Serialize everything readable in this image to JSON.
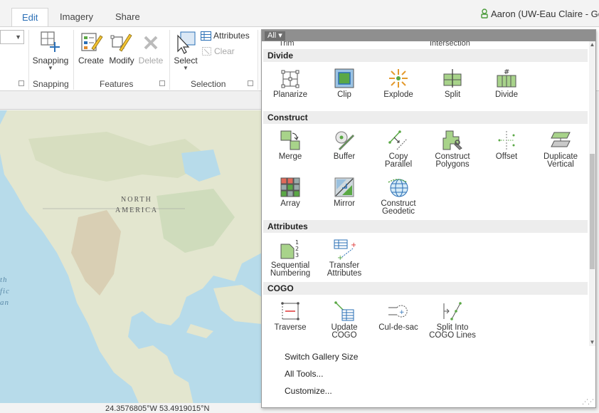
{
  "tabs": [
    {
      "label": "Edit",
      "active": true
    },
    {
      "label": "Imagery",
      "active": false
    },
    {
      "label": "Share",
      "active": false
    }
  ],
  "user": {
    "label": "Aaron (UW-Eau Claire - Geog"
  },
  "ribbon": {
    "snapping": {
      "button_label": "Snapping",
      "group_label": "Snapping"
    },
    "features": {
      "create": "Create",
      "modify": "Modify",
      "delete": "Delete",
      "group_label": "Features"
    },
    "selection": {
      "select": "Select",
      "attributes": "Attributes",
      "clear": "Clear",
      "group_label": "Selection"
    }
  },
  "map": {
    "labels": {
      "north": "NORTH",
      "america": "AMERICA",
      "pacific_1": "th",
      "pacific_2": "fic",
      "pacific_3": "an"
    }
  },
  "status": {
    "coordinates": "24.3576805°W 53.4919015°N"
  },
  "gallery": {
    "filter_label": "All",
    "cut_labels": [
      "Trim",
      "Intersection"
    ],
    "categories": {
      "divide": "Divide",
      "construct": "Construct",
      "attributes": "Attributes",
      "cogo": "COGO"
    },
    "tools": {
      "planarize": {
        "l1": "Planarize",
        "l2": ""
      },
      "clip": {
        "l1": "Clip",
        "l2": ""
      },
      "explode": {
        "l1": "Explode",
        "l2": ""
      },
      "split": {
        "l1": "Split",
        "l2": ""
      },
      "divide": {
        "l1": "Divide",
        "l2": ""
      },
      "merge": {
        "l1": "Merge",
        "l2": ""
      },
      "buffer": {
        "l1": "Buffer",
        "l2": ""
      },
      "copy_parallel": {
        "l1": "Copy",
        "l2": "Parallel"
      },
      "construct_polygons": {
        "l1": "Construct",
        "l2": "Polygons"
      },
      "offset": {
        "l1": "Offset",
        "l2": ""
      },
      "duplicate_vertical": {
        "l1": "Duplicate",
        "l2": "Vertical"
      },
      "array": {
        "l1": "Array",
        "l2": ""
      },
      "mirror": {
        "l1": "Mirror",
        "l2": ""
      },
      "construct_geodetic": {
        "l1": "Construct",
        "l2": "Geodetic"
      },
      "sequential_numbering": {
        "l1": "Sequential",
        "l2": "Numbering"
      },
      "transfer_attributes": {
        "l1": "Transfer",
        "l2": "Attributes"
      },
      "traverse": {
        "l1": "Traverse",
        "l2": ""
      },
      "update_cogo": {
        "l1": "Update",
        "l2": "COGO"
      },
      "cul_de_sac": {
        "l1": "Cul-de-sac",
        "l2": ""
      },
      "split_into_cogo_lines": {
        "l1": "Split Into",
        "l2": "COGO Lines"
      }
    },
    "menu": {
      "switch_size": "Switch Gallery Size",
      "all_tools": "All Tools...",
      "customize": "Customize..."
    }
  },
  "colors": {
    "accent": "#2a6fb6",
    "tool_green": "#5aa845",
    "map_water": "#b7dbea",
    "map_land": "#e3e6cf"
  }
}
